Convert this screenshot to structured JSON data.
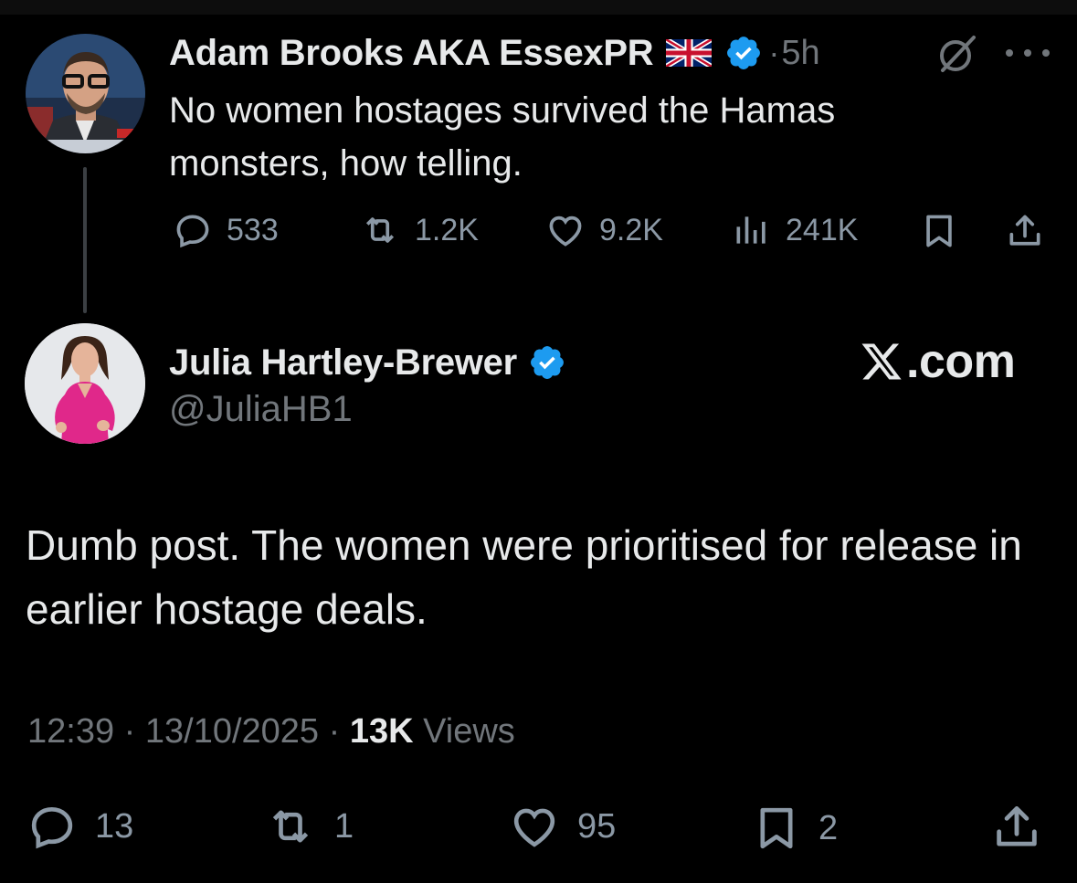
{
  "parent_tweet": {
    "author_name": "Adam Brooks AKA EssexPR",
    "separator": "·",
    "time_ago": "5h",
    "text": "No women hostages survived the Hamas monsters, how telling.",
    "actions": {
      "replies": "533",
      "reposts": "1.2K",
      "likes": "9.2K",
      "views": "241K"
    },
    "icons": [
      "grok-icon",
      "more-icon",
      "reply-icon",
      "repost-icon",
      "like-icon",
      "views-icon",
      "bookmark-icon",
      "share-icon"
    ]
  },
  "main_tweet": {
    "author_name": "Julia Hartley-Brewer",
    "handle": "@JuliaHB1",
    "text": "Dumb post. The women were prioritised for release in earlier hostage deals.",
    "time": "12:39",
    "date": "13/10/2025",
    "separator": "·",
    "views_count": "13K",
    "views_label": "Views",
    "actions": {
      "replies": "13",
      "reposts": "1",
      "likes": "95",
      "bookmarks": "2"
    }
  },
  "watermark": {
    "text": ".com"
  },
  "colors": {
    "background": "#000000",
    "primary_text": "#e7e9ea",
    "secondary_text": "#71767b",
    "verified_blue": "#1d9bf0",
    "thread_line": "#3b3f43"
  }
}
